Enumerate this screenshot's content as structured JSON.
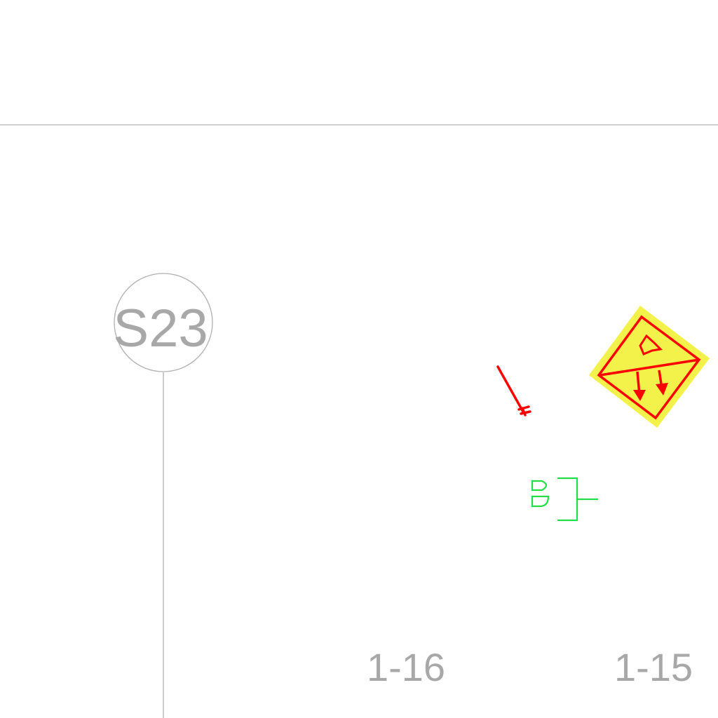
{
  "gridline": {
    "label": "S23"
  },
  "room_labels": [
    {
      "text": "1-16"
    },
    {
      "text": "1-15"
    }
  ],
  "symbols": {
    "escape_sign": {
      "icon": "emergency-exit-sign-icon"
    },
    "red_device": {
      "icon": "sprinkler-pendant-icon"
    },
    "green_fixture": {
      "icon": "light-fixture-icon"
    }
  },
  "colors": {
    "linework_gray": "#a8a8a8",
    "symbol_red": "#ff0000",
    "sign_fill_yellow": "#f2f24a",
    "fixture_green": "#22dd44"
  }
}
